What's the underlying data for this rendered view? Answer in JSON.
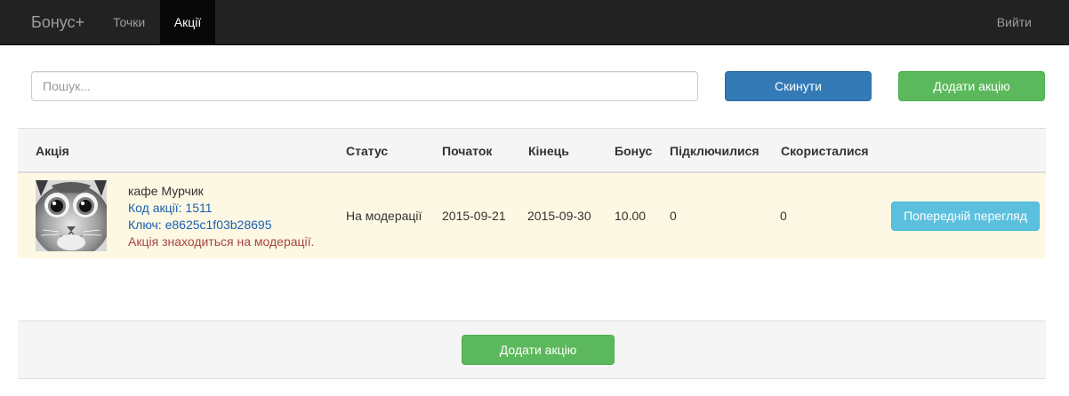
{
  "navbar": {
    "brand": "Бонус+",
    "items": [
      {
        "label": "Точки",
        "active": false
      },
      {
        "label": "Акції",
        "active": true
      }
    ],
    "logout": "Вийти"
  },
  "search": {
    "placeholder": "Пошук...",
    "value": ""
  },
  "toolbar": {
    "reset_label": "Скинути",
    "add_label": "Додати акцію"
  },
  "table": {
    "headers": [
      "Акція",
      "Статус",
      "Початок",
      "Кінець",
      "Бонус",
      "Підключилися",
      "Скористалися"
    ],
    "rows": [
      {
        "image": "cat-photo",
        "name": "кафе Мурчик",
        "code": "Код акції: 1511",
        "key": "Ключ: e8625c1f03b28695",
        "moderation_note": "Акція знаходиться на модерації.",
        "status": "На модерації",
        "start": "2015-09-21",
        "end": "2015-09-30",
        "bonus": "10.00",
        "joined": "0",
        "used": "0",
        "action_label": "Попередній перегляд"
      }
    ]
  },
  "footer": {
    "add_label": "Додати акцію"
  },
  "colors": {
    "navbar": "#222222",
    "primary": "#337ab7",
    "success": "#5cb85c",
    "info": "#5bc0de",
    "warning_row": "#fcf8e3",
    "danger_text": "#a94442"
  }
}
